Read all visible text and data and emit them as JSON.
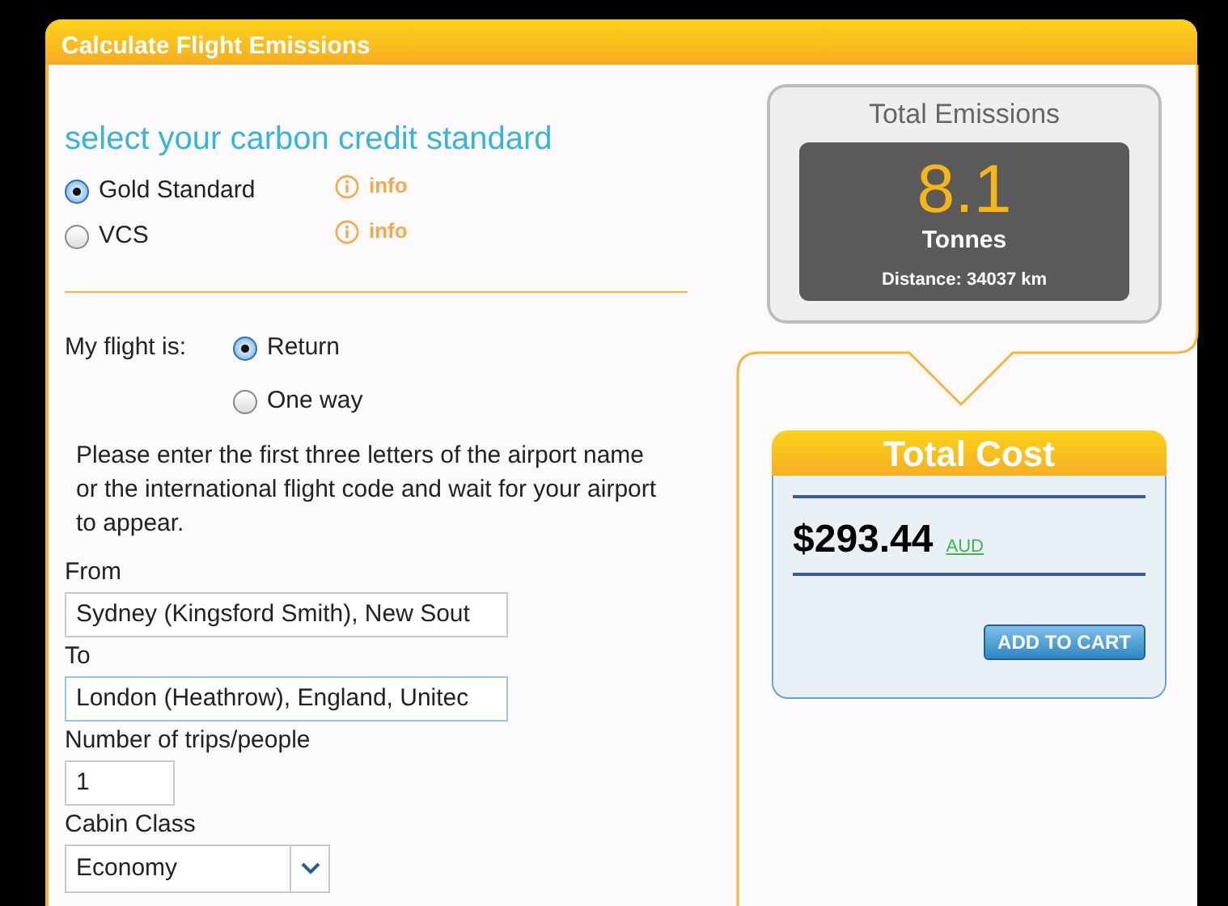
{
  "panel": {
    "title": "Calculate Flight Emissions"
  },
  "standard": {
    "heading": "select your carbon credit standard",
    "options": [
      {
        "label": "Gold Standard",
        "selected": true,
        "info": "info"
      },
      {
        "label": "VCS",
        "selected": false,
        "info": "info"
      }
    ]
  },
  "flight": {
    "label": "My flight is:",
    "options": [
      {
        "label": "Return",
        "selected": true
      },
      {
        "label": "One way",
        "selected": false
      }
    ]
  },
  "instructions": "Please enter the first three letters of the airport name or the international flight code and wait for your airport to appear.",
  "from": {
    "label": "From",
    "value": "Sydney (Kingsford Smith), New Sout",
    "focused": false
  },
  "to": {
    "label": "To",
    "value": "London (Heathrow), England, Unitec",
    "focused": true
  },
  "trips": {
    "label": "Number of trips/people",
    "value": "1"
  },
  "cabin": {
    "label": "Cabin Class",
    "value": "Economy"
  },
  "emissions": {
    "title": "Total Emissions",
    "value": "8.1",
    "unit": "Tonnes",
    "distance": "Distance: 34037 km"
  },
  "cost": {
    "title": "Total Cost",
    "amount": "$293.44",
    "currency": "AUD",
    "button": "ADD TO CART"
  }
}
